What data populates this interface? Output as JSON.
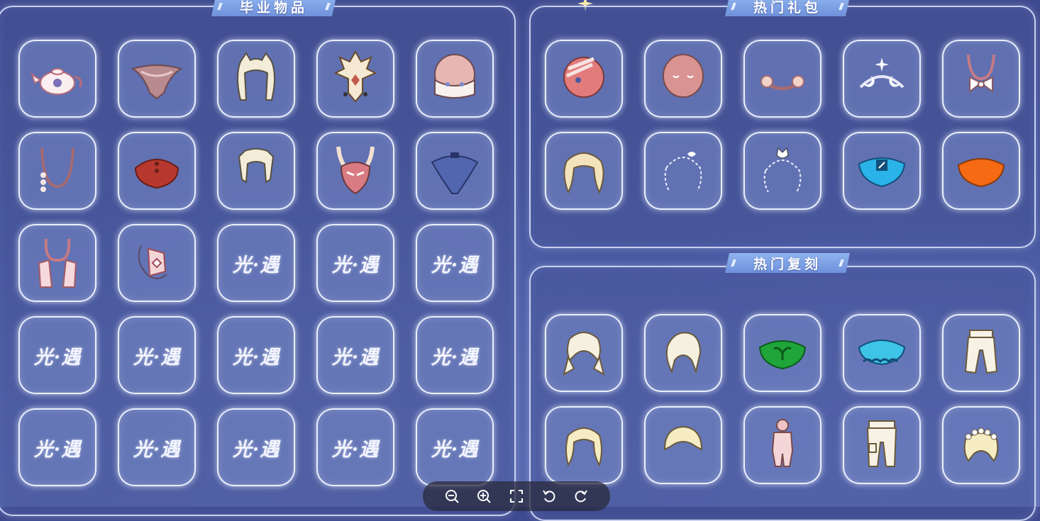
{
  "sections": {
    "graduation": {
      "title": "毕业物品"
    },
    "packs": {
      "title": "热门礼包"
    },
    "reprint": {
      "title": "热门复刻"
    }
  },
  "placeholder_logo": "光·遇",
  "graduation_items": [
    {
      "icon": "teapot-prop-icon"
    },
    {
      "icon": "feather-cape-icon"
    },
    {
      "icon": "pale-hair-icon"
    },
    {
      "icon": "ornate-mask-icon"
    },
    {
      "icon": "veiled-face-mask-icon"
    },
    {
      "icon": "pendant-necklace-icon"
    },
    {
      "icon": "red-cape-icon"
    },
    {
      "icon": "pale-hair-short-icon"
    },
    {
      "icon": "horned-mask-icon"
    },
    {
      "icon": "blue-cape-icon"
    },
    {
      "icon": "long-scarf-icon"
    },
    {
      "icon": "swirl-prop-icon"
    },
    {
      "icon": "placeholder"
    },
    {
      "icon": "placeholder"
    },
    {
      "icon": "placeholder"
    },
    {
      "icon": "placeholder"
    },
    {
      "icon": "placeholder"
    },
    {
      "icon": "placeholder"
    },
    {
      "icon": "placeholder"
    },
    {
      "icon": "placeholder"
    },
    {
      "icon": "placeholder"
    },
    {
      "icon": "placeholder"
    },
    {
      "icon": "placeholder"
    },
    {
      "icon": "placeholder"
    },
    {
      "icon": "placeholder"
    }
  ],
  "pack_items": [
    {
      "icon": "bandaged-mask-icon"
    },
    {
      "icon": "sleepy-mask-icon"
    },
    {
      "icon": "flower-headband-icon"
    },
    {
      "icon": "moon-star-headband-icon"
    },
    {
      "icon": "bow-necklace-icon"
    },
    {
      "icon": "curly-hair-icon"
    },
    {
      "icon": "outline-hair-shell-icon"
    },
    {
      "icon": "outline-hair-cat-icon"
    },
    {
      "icon": "cyan-cape-icon"
    },
    {
      "icon": "orange-cape-icon"
    }
  ],
  "reprint_items": [
    {
      "icon": "pigtail-hair-icon"
    },
    {
      "icon": "ponytail-hair-icon"
    },
    {
      "icon": "green-sprout-cape-icon"
    },
    {
      "icon": "cyan-cloud-cape-icon"
    },
    {
      "icon": "puffy-pants-icon"
    },
    {
      "icon": "wavy-hair-icon"
    },
    {
      "icon": "short-hair-icon"
    },
    {
      "icon": "pink-outfit-icon"
    },
    {
      "icon": "cargo-pants-icon"
    },
    {
      "icon": "flower-crown-hair-icon"
    }
  ],
  "toolbar": [
    "zoom-out-icon",
    "zoom-in-icon",
    "fit-screen-icon",
    "rotate-left-icon",
    "rotate-right-icon"
  ],
  "colors": {
    "panel_border": "#e1e8ff",
    "banner": "#7fa2e6",
    "background": "#4a5aa2"
  }
}
